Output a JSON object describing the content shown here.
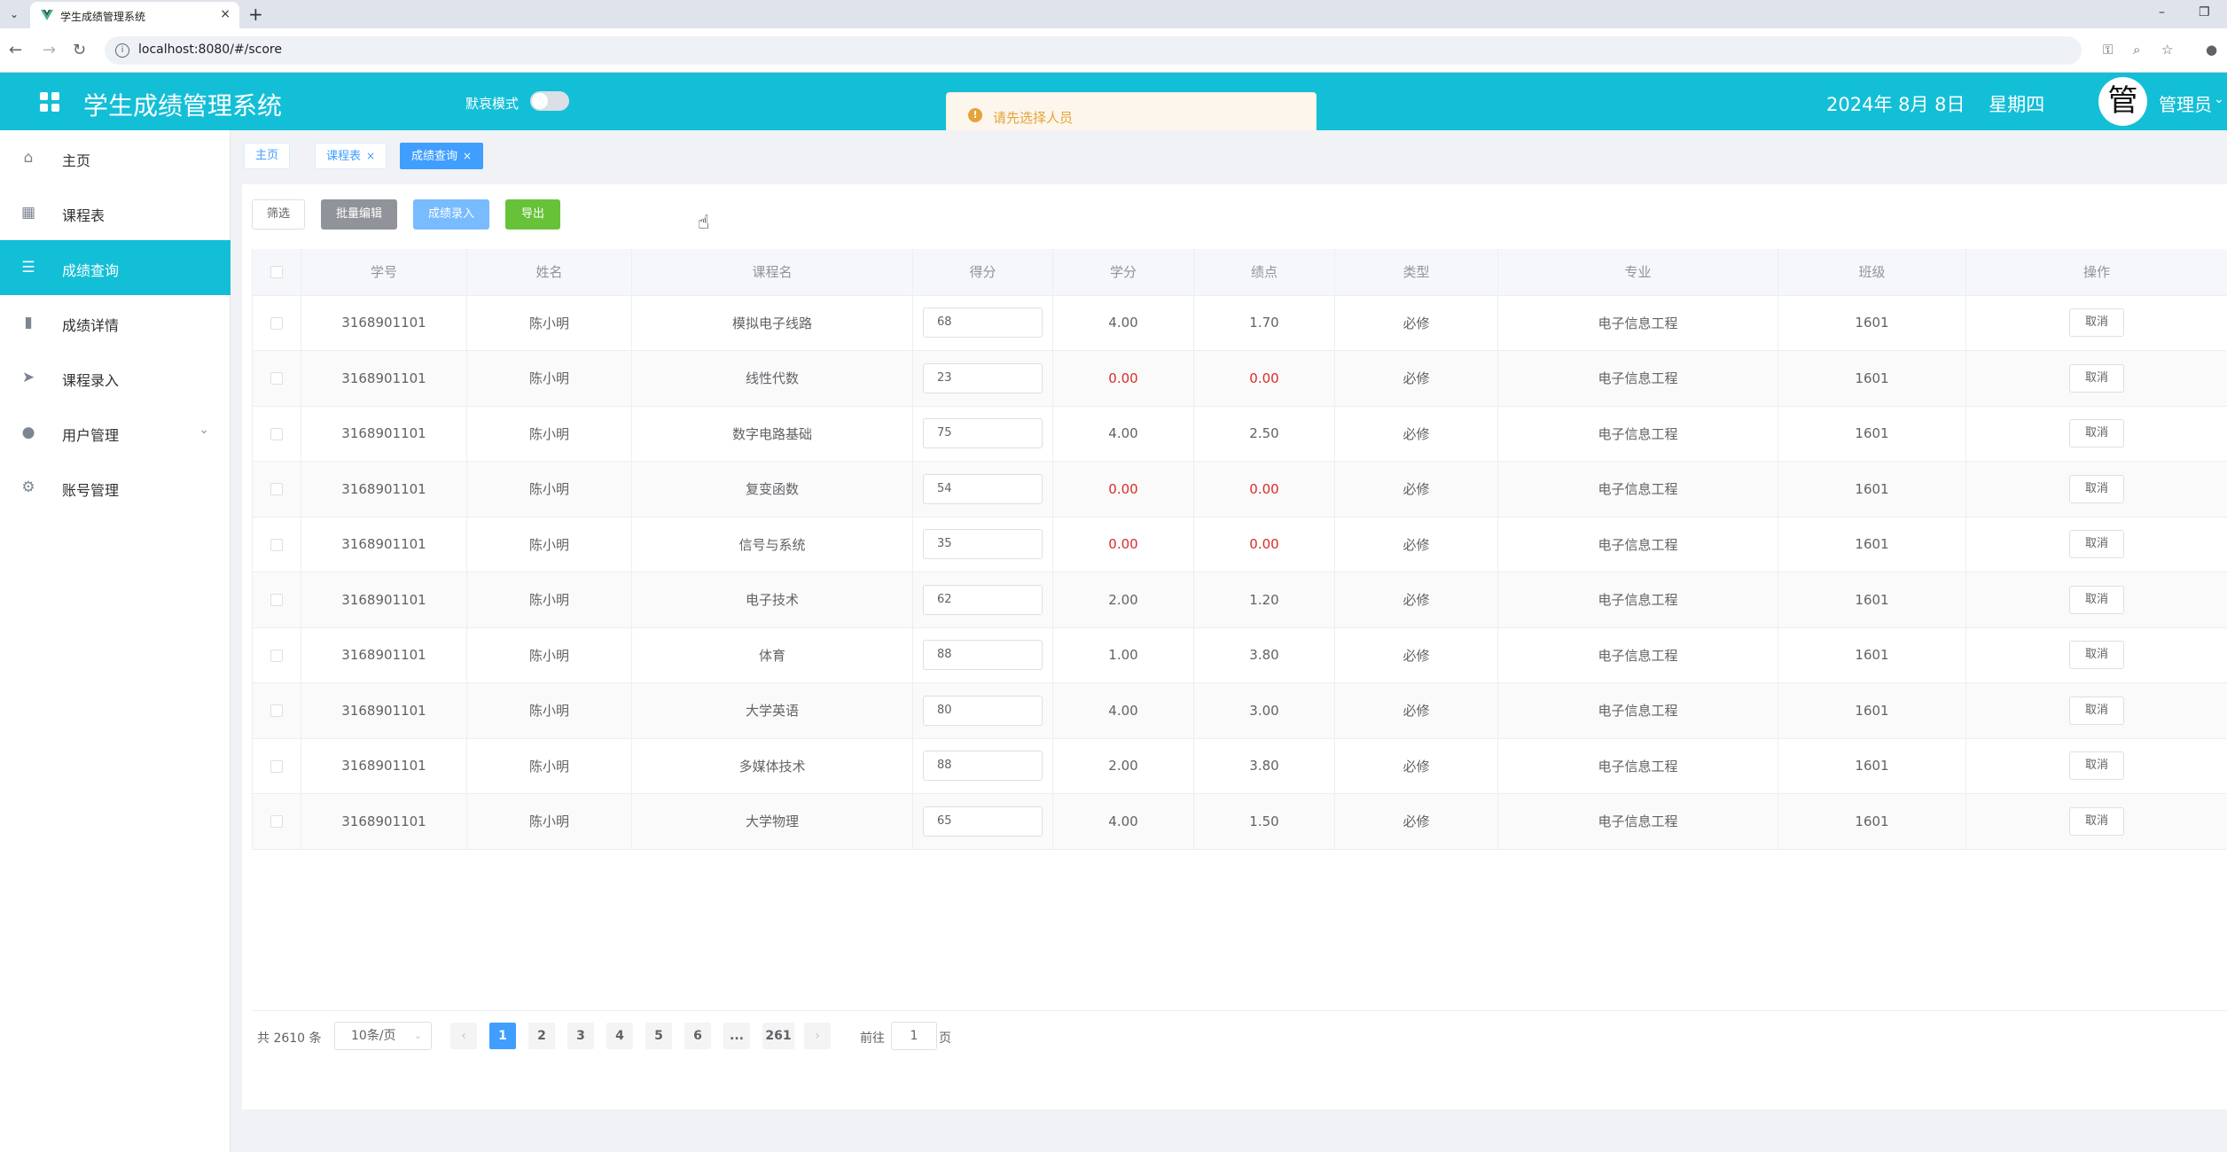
{
  "browser": {
    "tab_title": "学生成绩管理系统",
    "tab_close": "×",
    "new_tab": "+",
    "url": "localhost:8080/#/score"
  },
  "header": {
    "title": "学生成绩管理系统",
    "dark_mode_label": "默哀模式",
    "date": "2024年 8月 8日    星期四",
    "avatar_text": "管",
    "user_name": "管理员"
  },
  "toast": {
    "message": "请先选择人员"
  },
  "sidebar": {
    "items": [
      {
        "label": "主页",
        "icon": "home-icon"
      },
      {
        "label": "课程表",
        "icon": "grid-icon"
      },
      {
        "label": "成绩查询",
        "icon": "list-icon",
        "active": true
      },
      {
        "label": "成绩详情",
        "icon": "bar-chart-icon"
      },
      {
        "label": "课程录入",
        "icon": "send-icon"
      },
      {
        "label": "用户管理",
        "icon": "user-icon"
      },
      {
        "label": "账号管理",
        "icon": "gear-icon"
      }
    ]
  },
  "tags": [
    {
      "label": "主页",
      "closable": false
    },
    {
      "label": "课程表",
      "closable": true
    },
    {
      "label": "成绩查询",
      "closable": true,
      "active": true
    }
  ],
  "toolbar": {
    "filter": "筛选",
    "batch_edit": "批量编辑",
    "score_entry": "成绩录入",
    "export": "导出"
  },
  "table": {
    "columns": [
      "学号",
      "姓名",
      "课程名",
      "得分",
      "学分",
      "绩点",
      "类型",
      "专业",
      "班级",
      "操作"
    ],
    "cancel_label": "取消",
    "rows": [
      {
        "id": "3168901101",
        "name": "陈小明",
        "course": "模拟电子线路",
        "score": "68",
        "credit": "4.00",
        "gpa": "1.70",
        "type": "必修",
        "major": "电子信息工程",
        "class": "1601"
      },
      {
        "id": "3168901101",
        "name": "陈小明",
        "course": "线性代数",
        "score": "23",
        "credit": "0.00",
        "gpa": "0.00",
        "type": "必修",
        "major": "电子信息工程",
        "class": "1601"
      },
      {
        "id": "3168901101",
        "name": "陈小明",
        "course": "数字电路基础",
        "score": "75",
        "credit": "4.00",
        "gpa": "2.50",
        "type": "必修",
        "major": "电子信息工程",
        "class": "1601"
      },
      {
        "id": "3168901101",
        "name": "陈小明",
        "course": "复变函数",
        "score": "54",
        "credit": "0.00",
        "gpa": "0.00",
        "type": "必修",
        "major": "电子信息工程",
        "class": "1601"
      },
      {
        "id": "3168901101",
        "name": "陈小明",
        "course": "信号与系统",
        "score": "35",
        "credit": "0.00",
        "gpa": "0.00",
        "type": "必修",
        "major": "电子信息工程",
        "class": "1601"
      },
      {
        "id": "3168901101",
        "name": "陈小明",
        "course": "电子技术",
        "score": "62",
        "credit": "2.00",
        "gpa": "1.20",
        "type": "必修",
        "major": "电子信息工程",
        "class": "1601"
      },
      {
        "id": "3168901101",
        "name": "陈小明",
        "course": "体育",
        "score": "88",
        "credit": "1.00",
        "gpa": "3.80",
        "type": "必修",
        "major": "电子信息工程",
        "class": "1601"
      },
      {
        "id": "3168901101",
        "name": "陈小明",
        "course": "大学英语",
        "score": "80",
        "credit": "4.00",
        "gpa": "3.00",
        "type": "必修",
        "major": "电子信息工程",
        "class": "1601"
      },
      {
        "id": "3168901101",
        "name": "陈小明",
        "course": "多媒体技术",
        "score": "88",
        "credit": "2.00",
        "gpa": "3.80",
        "type": "必修",
        "major": "电子信息工程",
        "class": "1601"
      },
      {
        "id": "3168901101",
        "name": "陈小明",
        "course": "大学物理",
        "score": "65",
        "credit": "4.00",
        "gpa": "1.50",
        "type": "必修",
        "major": "电子信息工程",
        "class": "1601"
      }
    ]
  },
  "pagination": {
    "total": "共 2610 条",
    "page_size": "10条/页",
    "prev": "‹",
    "next": "›",
    "pages": [
      "1",
      "2",
      "3",
      "4",
      "5",
      "6",
      "...",
      "261"
    ],
    "current": "1",
    "goto_label": "前往",
    "goto_value": "1",
    "page_suffix": "页"
  },
  "colors": {
    "header_bg": "#13bfd7",
    "active_menu": "#13bfd7",
    "primary": "#409eff",
    "fail_text": "#d92b2b",
    "warning": "#e6a23c"
  }
}
